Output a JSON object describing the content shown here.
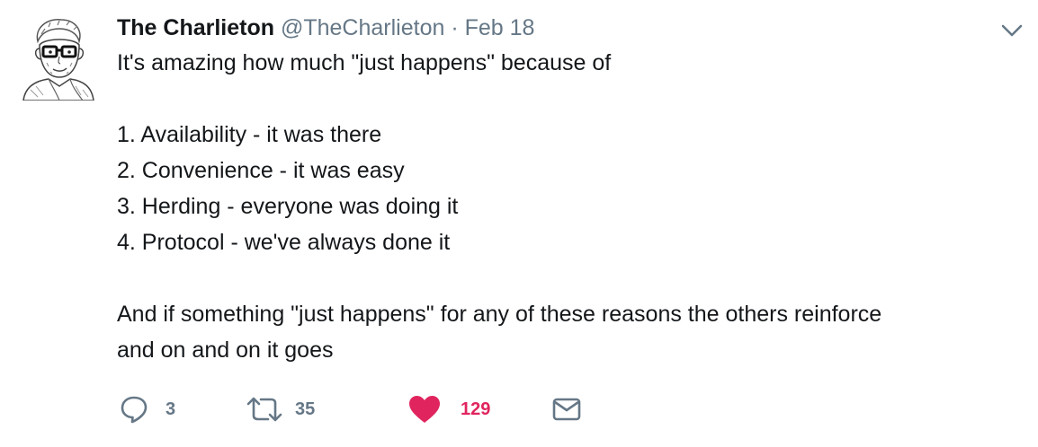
{
  "tweet": {
    "name": "The Charlieton",
    "handle": "@TheCharlieton",
    "separator": "·",
    "date": "Feb 18",
    "lines": [
      "It's amazing how much \"just happens\" because of",
      "",
      "1. Availability - it was there",
      "2. Convenience - it was easy",
      "3. Herding - everyone was doing it",
      "4. Protocol - we've always done it",
      "",
      "And if something \"just happens\" for any of these reasons the others reinforce",
      "and on and on it goes"
    ]
  },
  "actions": {
    "reply": {
      "icon": "reply-icon",
      "count": "3"
    },
    "retweet": {
      "icon": "retweet-icon",
      "count": "35"
    },
    "like": {
      "icon": "heart-icon",
      "count": "129",
      "active": true
    },
    "message": {
      "icon": "envelope-icon"
    }
  },
  "colors": {
    "text": "#14171a",
    "secondary": "#657786",
    "like": "#e0245e"
  }
}
